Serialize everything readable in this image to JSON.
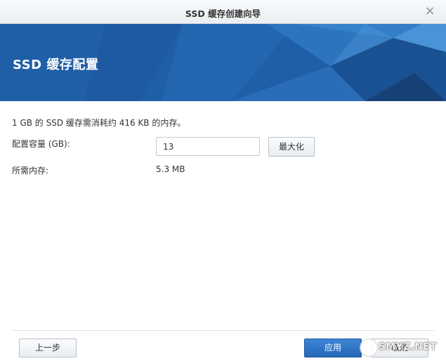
{
  "window": {
    "title": "SSD 缓存创建向导",
    "close_glyph": "×"
  },
  "banner": {
    "title": "SSD 缓存配置",
    "color": "#1f5fa8"
  },
  "content": {
    "info_text": "1 GB 的 SSD 缓存需消耗约 416 KB 的内存。",
    "capacity_label": "配置容量 (GB):",
    "capacity_value": "13",
    "max_button": "最大化",
    "memory_label": "所需内存:",
    "memory_value": "5.3 MB"
  },
  "footer": {
    "prev_button": "上一步",
    "apply_button": "应用",
    "cancel_button": "取消",
    "apply_color": "#2d74c4"
  },
  "watermark": {
    "text": "SMYZ.NET"
  }
}
